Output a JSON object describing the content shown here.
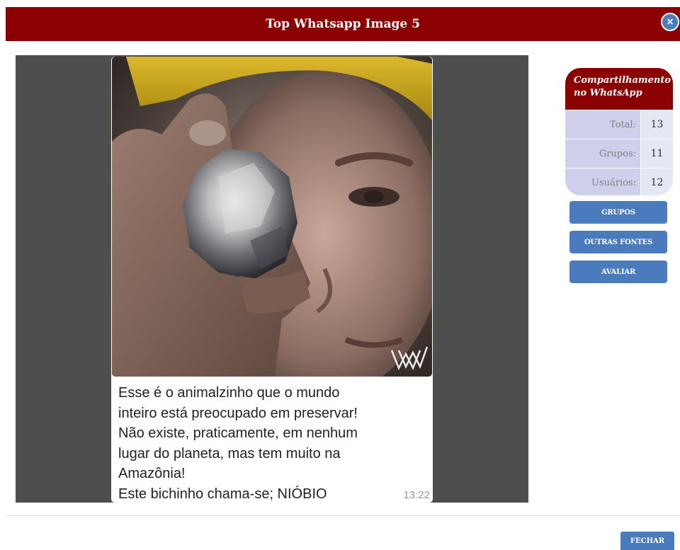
{
  "modal": {
    "title": "Top Whatsapp Image 5",
    "close_icon": "×",
    "footer_button": "FECHAR"
  },
  "message": {
    "text": "Esse é o animalzinho que o mundo\ninteiro está preocupado em preservar!\nNão existe, praticamente, em nenhum\nlugar do planeta, mas tem muito na\nAmazônia!\nEste bichinho chama-se; NIÓBIO",
    "time": "13:22",
    "image": "photo of a miner wearing a yellow helmet holding a shiny silver niobium rock, with a watermark logo"
  },
  "stats": {
    "title": "Compartilhamento no WhatsApp",
    "rows": [
      {
        "label": "Total:",
        "value": "13"
      },
      {
        "label": "Grupos:",
        "value": "11"
      },
      {
        "label": "Usuários:",
        "value": "12"
      }
    ]
  },
  "sidebar": {
    "buttons": [
      "GRUPOS",
      "OUTRAS FONTES",
      "AVALIAR"
    ]
  },
  "colors": {
    "header": "#8b0000",
    "button": "#4a7bbd",
    "viewer_background": "#4e4e4e",
    "stats_label_bg": "#cfcfec"
  }
}
